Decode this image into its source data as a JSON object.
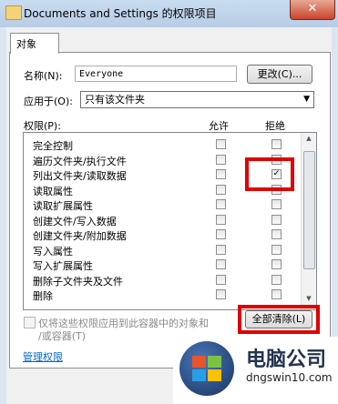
{
  "window": {
    "title": "Documents and Settings 的权限项目",
    "close_glyph": "✕"
  },
  "tab": {
    "label": "对象"
  },
  "name_row": {
    "label": "名称(N):",
    "value": "Everyone",
    "change_button": "更改(C)..."
  },
  "apply_row": {
    "label": "应用于(O):",
    "selected": "只有该文件夹"
  },
  "permissions": {
    "header_label": "权限(P):",
    "allow_header": "允许",
    "deny_header": "拒绝",
    "rows": [
      {
        "name": "完全控制",
        "allow": false,
        "deny": false
      },
      {
        "name": "遍历文件夹/执行文件",
        "allow": false,
        "deny": false
      },
      {
        "name": "列出文件夹/读取数据",
        "allow": false,
        "deny": true
      },
      {
        "name": "读取属性",
        "allow": false,
        "deny": false
      },
      {
        "name": "读取扩展属性",
        "allow": false,
        "deny": false
      },
      {
        "name": "创建文件/写入数据",
        "allow": false,
        "deny": false
      },
      {
        "name": "创建文件夹/附加数据",
        "allow": false,
        "deny": false
      },
      {
        "name": "写入属性",
        "allow": false,
        "deny": false
      },
      {
        "name": "写入扩展属性",
        "allow": false,
        "deny": false
      },
      {
        "name": "删除子文件夹及文件",
        "allow": false,
        "deny": false
      },
      {
        "name": "删除",
        "allow": false,
        "deny": false
      }
    ]
  },
  "apply_only": {
    "line1": "仅将这些权限应用到此容器中的对象和",
    "line2": "/或容器(T)"
  },
  "clear_all_button": "全部清除(L)",
  "manage_link": "管理权限",
  "watermark": {
    "brand": "电脑公司",
    "url": "dngswin10.com"
  },
  "colors": {
    "highlight": "#e00000",
    "link": "#0066cc"
  }
}
